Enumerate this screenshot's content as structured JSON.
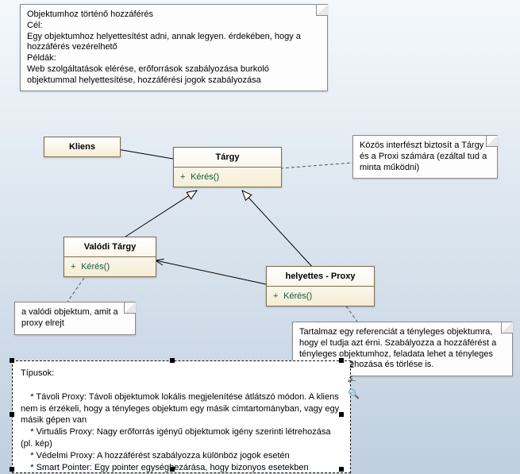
{
  "notes": {
    "main": "Objektumhoz történő hozzáférés\nCél:\nEgy objektumhoz helyettesítést adni, annak legyen. érdekében, hogy a hozzáférés vezérelhető\nPéldák:\nWeb szolgáltatások elérése, erőforrások szabályozása burkoló objektummal helyettesítése, hozzáférési jogok szabályozása",
    "interface": "Közös interfészt biztosít a Tárgy és a Proxi számára (ezáltal tud a minta működni)",
    "realobj": "a valódi objektum, amit a proxy elrejt",
    "proxy": "Tartalmaz egy referenciát a tényleges objektumra, hogy el tudja azt érni. Szabályozza a hozzáférést a tényleges objektumhoz, feladata lehet a tényleges objektum létrehozása és törlése is."
  },
  "classes": {
    "kliens": {
      "title": "Kliens"
    },
    "targy": {
      "title": "Tárgy",
      "op": "Kérés()"
    },
    "valodi": {
      "title": "Valódi Tárgy",
      "op": "Kérés()"
    },
    "proxy": {
      "title": "helyettes - Proxy",
      "op": "Kérés()"
    }
  },
  "types_note": "Típusok:\n\n    * Távoli Proxy: Távoli objektumok lokális megjelenítése átlátszó módon. A kliens nem is érzékeli, hogy a tényleges objektum egy másik címtartományban, vagy egy másik gépen van\n    * Virtuális Proxy: Nagy erőforrás igényű objektumok igény szerinti létrehozása (pl. kép)\n    * Védelmi Proxy: A hozzáférést szabályozza különböz jogok esetén\n    * Smart Pointer: Egy pointer egységbezárása, hogy bizonyos esetekben automatikus műveleteket hajtson végre (pl.:lockolás)",
  "chart_data": {
    "type": "uml-class-diagram",
    "pattern": "Proxy",
    "classes": [
      {
        "name": "Kliens",
        "operations": []
      },
      {
        "name": "Tárgy",
        "operations": [
          "+ Kérés()"
        ]
      },
      {
        "name": "Valódi Tárgy",
        "operations": [
          "+ Kérés()"
        ]
      },
      {
        "name": "helyettes - Proxy",
        "operations": [
          "+ Kérés()"
        ]
      }
    ],
    "relationships": [
      {
        "from": "Kliens",
        "to": "Tárgy",
        "type": "association"
      },
      {
        "from": "Valódi Tárgy",
        "to": "Tárgy",
        "type": "generalization"
      },
      {
        "from": "helyettes - Proxy",
        "to": "Tárgy",
        "type": "generalization"
      },
      {
        "from": "helyettes - Proxy",
        "to": "Valódi Tárgy",
        "type": "association"
      }
    ],
    "notes": [
      {
        "attached_to": "Tárgy",
        "text": "Közös interfészt biztosít a Tárgy és a Proxi számára (ezáltal tud a minta működni)"
      },
      {
        "attached_to": "Valódi Tárgy",
        "text": "a valódi objektum, amit a proxy elrejt"
      },
      {
        "attached_to": "helyettes - Proxy",
        "text": "Tartalmaz egy referenciát a tényleges objektumra, hogy el tudja azt érni. Szabályozza a hozzáférést a tényleges objektumhoz, feladata lehet a tényleges objektum létrehozása és törlése is."
      }
    ]
  }
}
